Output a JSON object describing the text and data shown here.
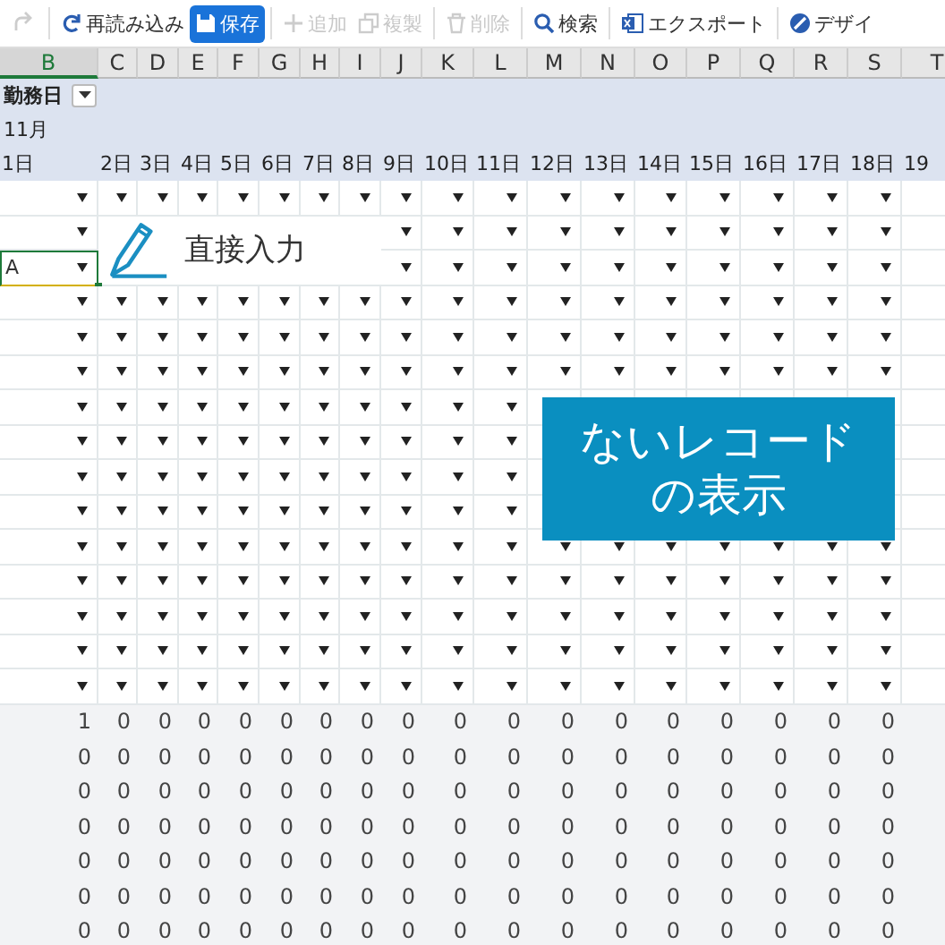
{
  "toolbar": [
    {
      "kind": "redo",
      "disabled": true
    },
    {
      "kind": "reload",
      "label": "再読み込み",
      "disabled": false,
      "primary": false
    },
    {
      "kind": "save",
      "label": "保存",
      "disabled": false,
      "primary": true
    },
    {
      "kind": "add",
      "label": "追加",
      "disabled": true,
      "primary": false
    },
    {
      "kind": "copy",
      "label": "複製",
      "disabled": true,
      "primary": false
    },
    {
      "kind": "delete",
      "label": "削除",
      "disabled": true,
      "primary": false
    },
    {
      "kind": "search",
      "label": "検索",
      "disabled": false,
      "primary": false
    },
    {
      "kind": "export",
      "label": "エクスポート",
      "disabled": false,
      "primary": false
    },
    {
      "kind": "design",
      "label": "デザイ",
      "disabled": false,
      "primary": false
    }
  ],
  "columns": [
    {
      "letter": "B",
      "selected": true
    },
    {
      "letter": "C",
      "selected": false
    },
    {
      "letter": "D",
      "selected": false
    },
    {
      "letter": "E",
      "selected": false
    },
    {
      "letter": "F",
      "selected": false
    },
    {
      "letter": "G",
      "selected": false
    },
    {
      "letter": "H",
      "selected": false
    },
    {
      "letter": "I",
      "selected": false
    },
    {
      "letter": "J",
      "selected": false
    },
    {
      "letter": "K",
      "selected": false
    },
    {
      "letter": "L",
      "selected": false
    },
    {
      "letter": "M",
      "selected": false
    },
    {
      "letter": "N",
      "selected": false
    },
    {
      "letter": "O",
      "selected": false
    },
    {
      "letter": "P",
      "selected": false
    },
    {
      "letter": "Q",
      "selected": false
    },
    {
      "letter": "R",
      "selected": false
    },
    {
      "letter": "S",
      "selected": false
    },
    {
      "letter": "T",
      "selected": false
    }
  ],
  "filter_label": "勤務日",
  "month": "11月",
  "dates": [
    "1日",
    "2日",
    "3日",
    "4日",
    "5日",
    "6日",
    "7日",
    "8日",
    "9日",
    "10日",
    "11日",
    "12日",
    "13日",
    "14日",
    "15日",
    "16日",
    "17日",
    "18日",
    "19"
  ],
  "entry_rows": [
    {
      "selected": false
    },
    {
      "selected": false
    },
    {
      "selected": true,
      "value": "A"
    },
    {
      "selected": false
    },
    {
      "selected": false
    },
    {
      "selected": false
    },
    {
      "selected": false
    },
    {
      "selected": false
    },
    {
      "selected": false
    },
    {
      "selected": false
    },
    {
      "selected": false
    },
    {
      "selected": false
    },
    {
      "selected": false
    },
    {
      "selected": false
    },
    {
      "selected": false
    }
  ],
  "count_rows": [
    [
      "1",
      "0",
      "0",
      "0",
      "0",
      "0",
      "0",
      "0",
      "0",
      "0",
      "0",
      "0",
      "0",
      "0",
      "0",
      "0",
      "0",
      "0"
    ],
    [
      "0",
      "0",
      "0",
      "0",
      "0",
      "0",
      "0",
      "0",
      "0",
      "0",
      "0",
      "0",
      "0",
      "0",
      "0",
      "0",
      "0",
      "0"
    ],
    [
      "0",
      "0",
      "0",
      "0",
      "0",
      "0",
      "0",
      "0",
      "0",
      "0",
      "0",
      "0",
      "0",
      "0",
      "0",
      "0",
      "0",
      "0"
    ],
    [
      "0",
      "0",
      "0",
      "0",
      "0",
      "0",
      "0",
      "0",
      "0",
      "0",
      "0",
      "0",
      "0",
      "0",
      "0",
      "0",
      "0",
      "0"
    ],
    [
      "0",
      "0",
      "0",
      "0",
      "0",
      "0",
      "0",
      "0",
      "0",
      "0",
      "0",
      "0",
      "0",
      "0",
      "0",
      "0",
      "0",
      "0"
    ],
    [
      "0",
      "0",
      "0",
      "0",
      "0",
      "0",
      "0",
      "0",
      "0",
      "0",
      "0",
      "0",
      "0",
      "0",
      "0",
      "0",
      "0",
      "0"
    ],
    [
      "0",
      "0",
      "0",
      "0",
      "0",
      "0",
      "0",
      "0",
      "0",
      "0",
      "0",
      "0",
      "0",
      "0",
      "0",
      "0",
      "0",
      "0"
    ]
  ],
  "callouts": [
    {
      "kind": "direct",
      "text": "直接入力"
    },
    {
      "kind": "missing",
      "lines": [
        "ないレコード",
        "の表示"
      ]
    }
  ]
}
